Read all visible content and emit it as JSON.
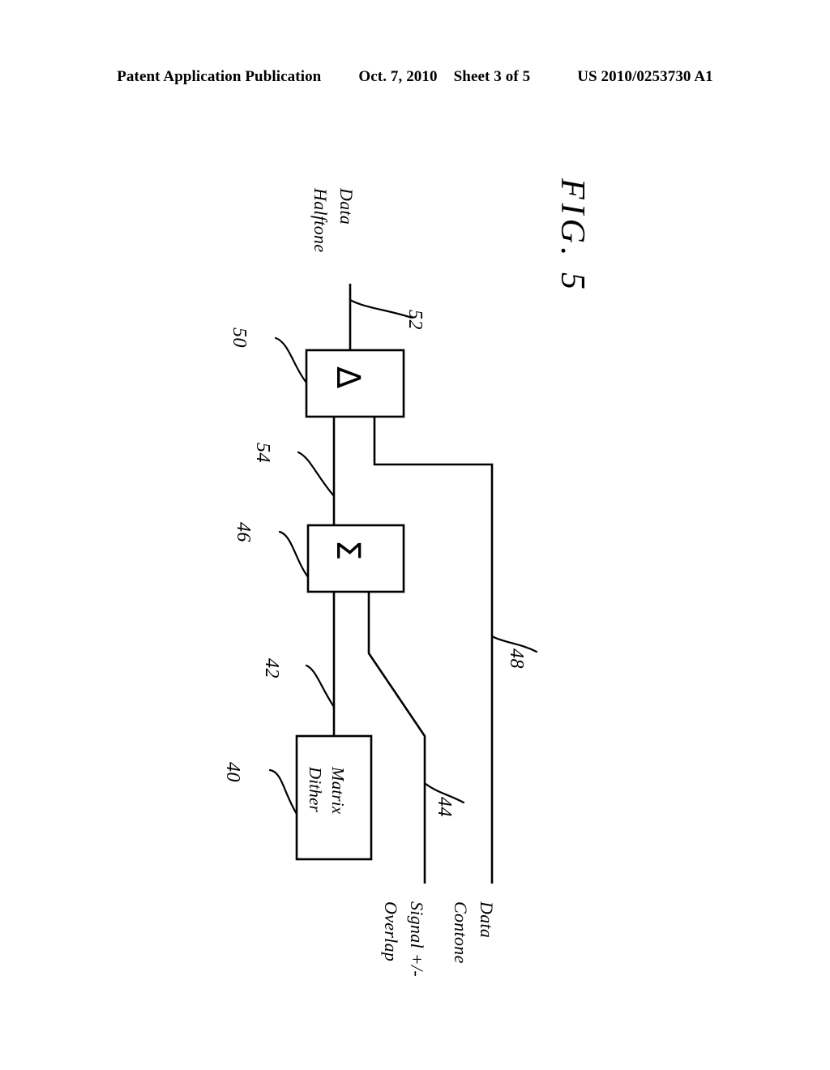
{
  "header": {
    "publication": "Patent Application Publication",
    "date": "Oct. 7, 2010",
    "sheet": "Sheet 3 of 5",
    "number": "US 2010/0253730 A1"
  },
  "figure": {
    "title": "FIG. 5",
    "blocks": [
      {
        "id": "dither-matrix",
        "label_line1": "Dither",
        "label_line2": "Matrix",
        "ref": "40"
      },
      {
        "id": "summation",
        "symbol": "Σ",
        "symbol_name": "sigma",
        "ref": "46"
      },
      {
        "id": "delta",
        "symbol": "Δ",
        "symbol_name": "delta",
        "ref": "50"
      }
    ],
    "signals": [
      {
        "id": "halftone-data",
        "line1": "Halftone",
        "line2": "Data",
        "ref": "52"
      },
      {
        "id": "overlap-signal",
        "line1": "Overlap",
        "line2": "Signal +/-",
        "ref": "44"
      },
      {
        "id": "contone-data",
        "line1": "Contone",
        "line2": "Data",
        "ref": "48"
      }
    ],
    "reference_numerals": {
      "dither_matrix": "40",
      "dither_output": "42",
      "overlap_signal": "44",
      "summation": "46",
      "contone_data": "48",
      "delta": "50",
      "halftone_data": "52",
      "sum_output": "54"
    }
  },
  "colors": {
    "ink": "#000000",
    "paper": "#ffffff"
  }
}
